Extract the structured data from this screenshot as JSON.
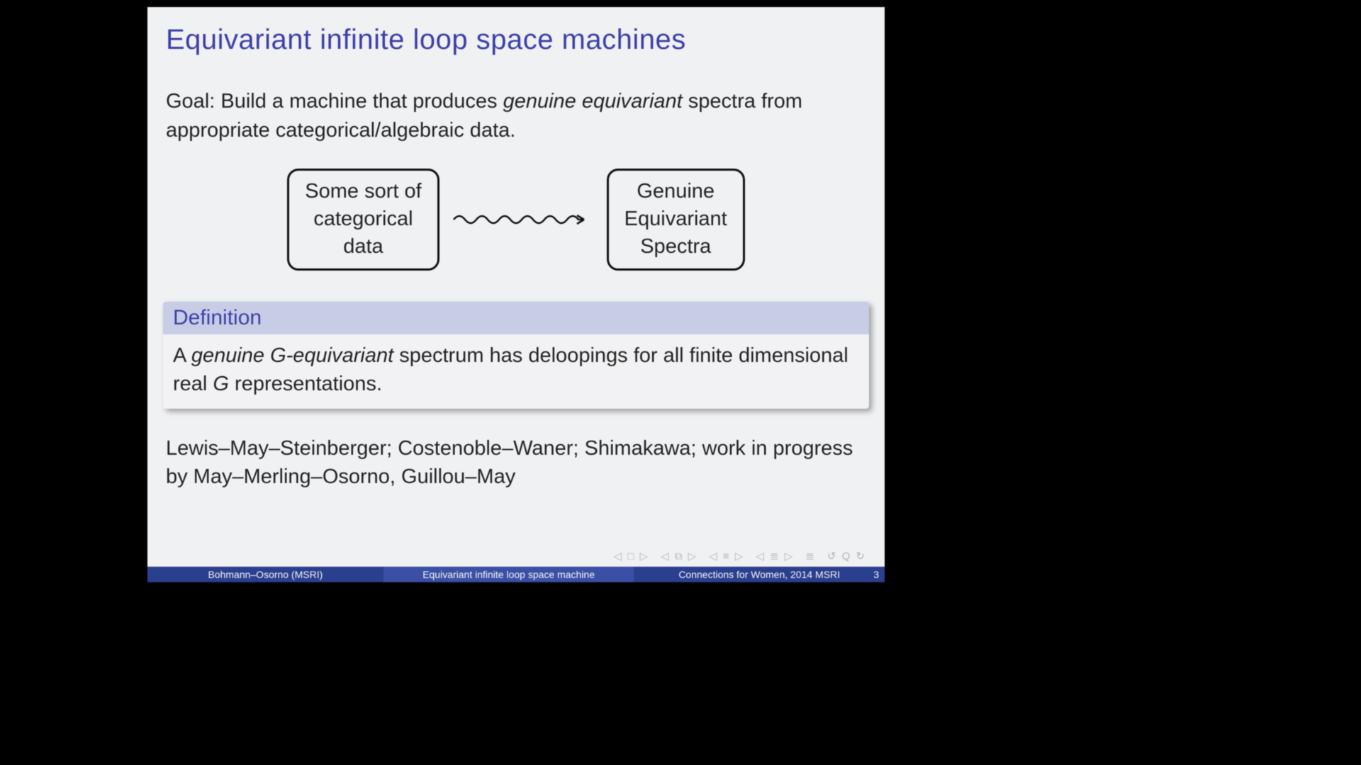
{
  "title": "Equivariant infinite loop space machines",
  "goal": {
    "label": "Goal:",
    "pre": " Build a machine that produces ",
    "emph": "genuine equivariant",
    "post": " spectra from appropriate categorical/algebraic data."
  },
  "diagram": {
    "left": "Some sort of\ncategorical\ndata",
    "right": "Genuine\nEquivariant\nSpectra"
  },
  "definition": {
    "heading": "Definition",
    "pre": "A ",
    "emph": "genuine G-equivariant",
    "mid": " spectrum has deloopings for all finite dimensional real ",
    "g": "G",
    "post": " representations."
  },
  "refs": "Lewis–May–Steinberger; Costenoble–Waner; Shimakawa; work in progress by May–Merling–Osorno, Guillou–May",
  "nav": [
    "◁ □ ▷",
    "◁ ⧉ ▷",
    "◁ ≡ ▷",
    "◁ ≣ ▷",
    "≣",
    "↺ Q ↻"
  ],
  "footer": {
    "author": "Bohmann–Osorno  (MSRI)",
    "talk": "Equivariant infinite loop space machine",
    "venue": "Connections for Women, 2014 MSRI",
    "page": "3"
  }
}
